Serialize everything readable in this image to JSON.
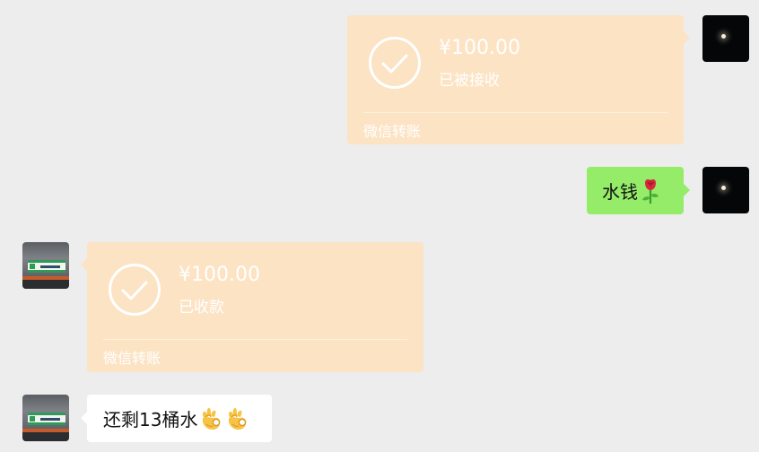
{
  "messages": [
    {
      "sender": "self",
      "type": "transfer",
      "amount": "¥100.00",
      "status": "已被接收",
      "footer": "微信转账"
    },
    {
      "sender": "self",
      "type": "text",
      "text": "水钱",
      "emoji": [
        "rose-emoji"
      ]
    },
    {
      "sender": "shop",
      "type": "transfer",
      "amount": "¥100.00",
      "status": "已收款",
      "footer": "微信转账"
    },
    {
      "sender": "shop",
      "type": "text",
      "text": "还剩13桶水",
      "emoji": [
        "ok-hand-emoji",
        "ok-hand-emoji"
      ]
    }
  ],
  "colors": {
    "background": "#ededed",
    "transfer_card": "#fce3c4",
    "self_bubble": "#95ec69",
    "other_bubble": "#ffffff"
  }
}
